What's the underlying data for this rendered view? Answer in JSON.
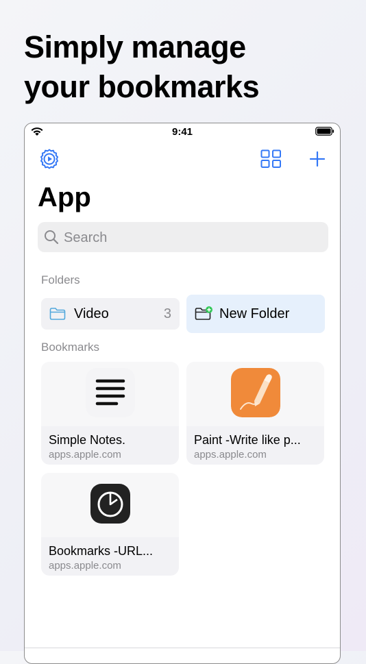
{
  "headline": {
    "line1": "Simply manage",
    "line2": "your bookmarks"
  },
  "status_bar": {
    "time": "9:41"
  },
  "navbar": {
    "left_icon": "settings-gear-icon",
    "grid_icon": "grid-view-icon",
    "add_icon": "plus-icon"
  },
  "title": "App",
  "search": {
    "placeholder": "Search",
    "value": ""
  },
  "folders": {
    "label": "Folders",
    "items": [
      {
        "label": "Video",
        "count": "3"
      },
      {
        "label": "New Folder"
      }
    ]
  },
  "bookmarks": {
    "label": "Bookmarks",
    "items": [
      {
        "title": "Simple Notes.",
        "url": "apps.apple.com"
      },
      {
        "title": "Paint -Write like p...",
        "url": "apps.apple.com"
      },
      {
        "title": "Bookmarks -URL...",
        "url": "apps.apple.com"
      }
    ]
  },
  "colors": {
    "accent": "#3478f6",
    "folder_bg": "#f1f1f4",
    "new_folder_bg": "#e6f0fc",
    "green_badge": "#34c759",
    "paint_orange": "#f08a3a",
    "dark_icon": "#222222"
  }
}
